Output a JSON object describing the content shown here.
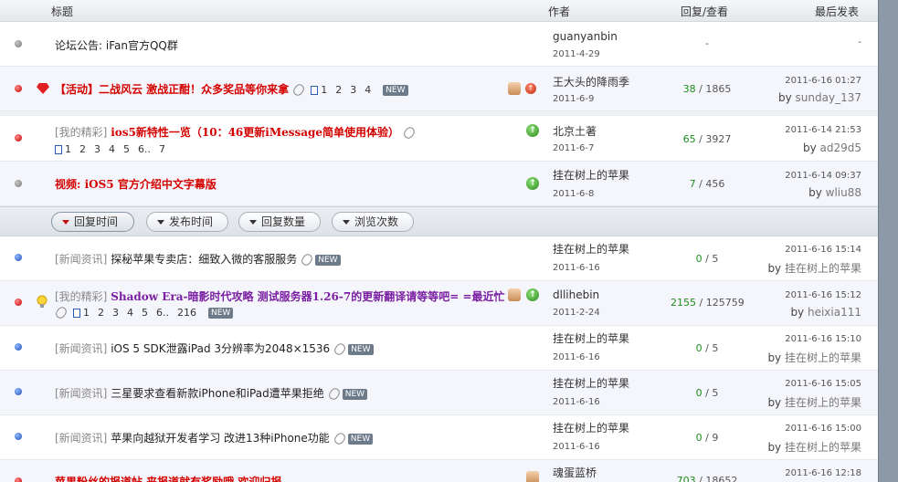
{
  "columns": {
    "title": "标题",
    "author": "作者",
    "replies": "回复/查看",
    "last": "最后发表"
  },
  "sort_buttons": [
    "回复时间",
    "发布时间",
    "回复数量",
    "浏览次数"
  ],
  "threads": [
    {
      "category": "",
      "title": "论坛公告: iFan官方QQ群",
      "author": "guanyanbin",
      "date": "2011-4-29",
      "replies": "",
      "views": "",
      "stat_text": "-",
      "last_date": "",
      "last_user": "",
      "last_dash": "-"
    },
    {
      "title": "【活动】二战风云 激战正酣！众多奖品等你来拿",
      "pages": [
        "1",
        "2",
        "3",
        "4"
      ],
      "new": "NEW",
      "author": "王大头的降雨季",
      "date": "2011-6-9",
      "replies": "38",
      "views": "1865",
      "last_date": "2011-6-16 01:27",
      "by": "by",
      "last_user": "sunday_137"
    },
    {
      "category": "[我的精彩]",
      "title": "ios5新特性一览（10：46更新iMessage简单使用体验）",
      "pages": [
        "1",
        "2",
        "3",
        "4",
        "5",
        "6..",
        "7"
      ],
      "author": "北京土著",
      "date": "2011-6-7",
      "replies": "65",
      "views": "3927",
      "last_date": "2011-6-14 21:53",
      "by": "by",
      "last_user": "ad29d5"
    },
    {
      "title": "视频: iOS5 官方介绍中文字幕版",
      "author": "挂在树上的苹果",
      "date": "2011-6-8",
      "replies": "7",
      "views": "456",
      "last_date": "2011-6-14 09:37",
      "by": "by",
      "last_user": "wliu88"
    },
    {
      "category": "[新闻资讯]",
      "title": "探秘苹果专卖店：细致入微的客服服务",
      "new": "NEW",
      "author": "挂在树上的苹果",
      "date": "2011-6-16",
      "replies": "0",
      "views": "5",
      "last_date": "2011-6-16 15:14",
      "by": "by",
      "last_user": "挂在树上的苹果"
    },
    {
      "category": "[我的精彩]",
      "title": "Shadow Era-暗影时代攻略 测试服务器1.26-7的更新翻译请等等吧= =最近忙",
      "pages": [
        "1",
        "2",
        "3",
        "4",
        "5",
        "6..",
        "216"
      ],
      "new": "NEW",
      "author": "dllihebin",
      "date": "2011-2-24",
      "replies": "2155",
      "views": "125759",
      "last_date": "2011-6-16 15:12",
      "by": "by",
      "last_user": "heixia111"
    },
    {
      "category": "[新闻资讯]",
      "title": "iOS 5 SDK泄露iPad 3分辨率为2048×1536",
      "new": "NEW",
      "author": "挂在树上的苹果",
      "date": "2011-6-16",
      "replies": "0",
      "views": "5",
      "last_date": "2011-6-16 15:10",
      "by": "by",
      "last_user": "挂在树上的苹果"
    },
    {
      "category": "[新闻资讯]",
      "title": "三星要求查看新款iPhone和iPad遭苹果拒绝",
      "new": "NEW",
      "author": "挂在树上的苹果",
      "date": "2011-6-16",
      "replies": "0",
      "views": "5",
      "last_date": "2011-6-16 15:05",
      "by": "by",
      "last_user": "挂在树上的苹果"
    },
    {
      "category": "[新闻资讯]",
      "title": "苹果向越狱开发者学习 改进13种iPhone功能",
      "new": "NEW",
      "author": "挂在树上的苹果",
      "date": "2011-6-16",
      "replies": "0",
      "views": "9",
      "last_date": "2011-6-16 15:00",
      "by": "by",
      "last_user": "挂在树上的苹果"
    },
    {
      "title": "苹果粉丝的报道帖 来报道就有奖励哦 欢迎归报",
      "author": "魂蛋蓝桥",
      "date": "",
      "replies": "703",
      "views": "18652",
      "last_date": "2011-6-16 12:18"
    }
  ]
}
